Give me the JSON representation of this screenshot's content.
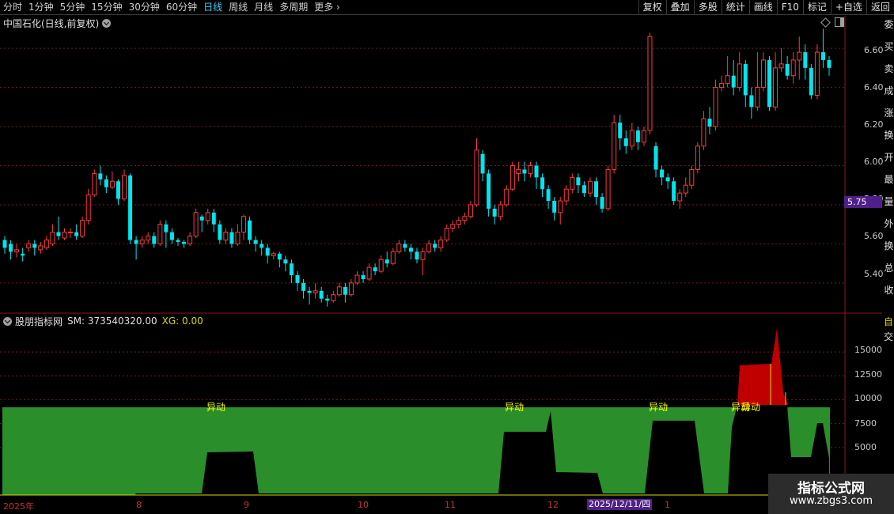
{
  "toolbar": {
    "periods": [
      "分时",
      "1分钟",
      "5分钟",
      "15分钟",
      "30分钟",
      "60分钟",
      "日线",
      "周线",
      "月线",
      "多周期",
      "更多"
    ],
    "active_period": "日线",
    "actions": [
      "复权",
      "叠加",
      "多股",
      "统计",
      "画线",
      "F10",
      "标记",
      "+自选",
      "返回"
    ]
  },
  "stock_title": "中国石化(日线,前复权)",
  "price_axis": [
    "6.60",
    "6.40",
    "6.20",
    "6.00",
    "5.80",
    "5.60",
    "5.40"
  ],
  "current_price_tag": "5.75",
  "right_strip_chars": [
    "委",
    "买",
    "卖",
    "成",
    "涨",
    "换",
    "开",
    "最",
    "量",
    "外",
    "换",
    "总",
    "收"
  ],
  "indicator": {
    "name": "股朋指标网",
    "sm_text": "SM: 373540320.00",
    "xg_text": "XG: 0.00",
    "axis": [
      "15000",
      "12500",
      "10000",
      "7500",
      "5000"
    ],
    "axis_top_char": "自",
    "axis_top_char2": "交",
    "yidong_labels": [
      "异动",
      "异动",
      "异动",
      "异动",
      "异动"
    ]
  },
  "date_axis": {
    "labels": [
      "2025年",
      "8",
      "9",
      "10",
      "11",
      "12",
      "1"
    ],
    "highlight": "2025/12/11/四"
  },
  "watermark": {
    "title": "指标公式网",
    "url": "www.zbgs3.com"
  },
  "colors": {
    "up": "#ff3b3b",
    "down": "#00e5ee",
    "green_fill": "#2a8f2a",
    "red_fill": "#c00000",
    "grid": "#7a1a1a",
    "highlight": "#50208a"
  },
  "chart_data": {
    "type": "candlestick",
    "ylim": [
      5.25,
      6.75
    ],
    "candles": [
      [
        5.62,
        5.58,
        5.55,
        5.64
      ],
      [
        5.6,
        5.56,
        5.52,
        5.62
      ],
      [
        5.56,
        5.57,
        5.53,
        5.6
      ],
      [
        5.55,
        5.54,
        5.51,
        5.58
      ],
      [
        5.58,
        5.6,
        5.56,
        5.62
      ],
      [
        5.6,
        5.58,
        5.54,
        5.62
      ],
      [
        5.57,
        5.59,
        5.55,
        5.61
      ],
      [
        5.58,
        5.62,
        5.57,
        5.64
      ],
      [
        5.6,
        5.66,
        5.59,
        5.7
      ],
      [
        5.66,
        5.64,
        5.62,
        5.74
      ],
      [
        5.63,
        5.66,
        5.62,
        5.68
      ],
      [
        5.66,
        5.66,
        5.63,
        5.68
      ],
      [
        5.66,
        5.64,
        5.62,
        5.7
      ],
      [
        5.64,
        5.72,
        5.63,
        5.74
      ],
      [
        5.72,
        5.85,
        5.7,
        5.88
      ],
      [
        5.85,
        5.96,
        5.84,
        5.98
      ],
      [
        5.96,
        5.93,
        5.9,
        6.0
      ],
      [
        5.93,
        5.89,
        5.86,
        5.95
      ],
      [
        5.89,
        5.92,
        5.88,
        5.97
      ],
      [
        5.92,
        5.83,
        5.8,
        5.93
      ],
      [
        5.83,
        5.95,
        5.82,
        5.98
      ],
      [
        5.95,
        5.62,
        5.6,
        5.96
      ],
      [
        5.62,
        5.6,
        5.52,
        5.64
      ],
      [
        5.6,
        5.62,
        5.58,
        5.64
      ],
      [
        5.62,
        5.64,
        5.6,
        5.66
      ],
      [
        5.64,
        5.6,
        5.58,
        5.66
      ],
      [
        5.6,
        5.7,
        5.59,
        5.72
      ],
      [
        5.7,
        5.66,
        5.58,
        5.72
      ],
      [
        5.66,
        5.62,
        5.6,
        5.68
      ],
      [
        5.62,
        5.61,
        5.59,
        5.63
      ],
      [
        5.61,
        5.6,
        5.58,
        5.62
      ],
      [
        5.6,
        5.64,
        5.59,
        5.66
      ],
      [
        5.64,
        5.76,
        5.63,
        5.78
      ],
      [
        5.74,
        5.72,
        5.66,
        5.75
      ],
      [
        5.72,
        5.76,
        5.7,
        5.78
      ],
      [
        5.76,
        5.7,
        5.66,
        5.78
      ],
      [
        5.7,
        5.62,
        5.6,
        5.72
      ],
      [
        5.62,
        5.66,
        5.6,
        5.68
      ],
      [
        5.66,
        5.6,
        5.58,
        5.68
      ],
      [
        5.6,
        5.66,
        5.59,
        5.7
      ],
      [
        5.66,
        5.74,
        5.62,
        5.75
      ],
      [
        5.72,
        5.62,
        5.6,
        5.74
      ],
      [
        5.62,
        5.6,
        5.56,
        5.64
      ],
      [
        5.6,
        5.58,
        5.54,
        5.62
      ],
      [
        5.58,
        5.54,
        5.5,
        5.6
      ],
      [
        5.54,
        5.55,
        5.52,
        5.56
      ],
      [
        5.55,
        5.52,
        5.48,
        5.56
      ],
      [
        5.52,
        5.5,
        5.46,
        5.54
      ],
      [
        5.5,
        5.44,
        5.4,
        5.52
      ],
      [
        5.44,
        5.4,
        5.36,
        5.46
      ],
      [
        5.4,
        5.36,
        5.32,
        5.42
      ],
      [
        5.36,
        5.35,
        5.29,
        5.38
      ],
      [
        5.35,
        5.36,
        5.32,
        5.4
      ],
      [
        5.36,
        5.32,
        5.3,
        5.38
      ],
      [
        5.32,
        5.31,
        5.28,
        5.34
      ],
      [
        5.31,
        5.34,
        5.3,
        5.36
      ],
      [
        5.34,
        5.38,
        5.33,
        5.4
      ],
      [
        5.38,
        5.34,
        5.3,
        5.4
      ],
      [
        5.34,
        5.4,
        5.33,
        5.42
      ],
      [
        5.4,
        5.44,
        5.39,
        5.46
      ],
      [
        5.44,
        5.42,
        5.4,
        5.46
      ],
      [
        5.42,
        5.48,
        5.41,
        5.5
      ],
      [
        5.48,
        5.46,
        5.44,
        5.5
      ],
      [
        5.46,
        5.52,
        5.45,
        5.54
      ],
      [
        5.52,
        5.5,
        5.48,
        5.56
      ],
      [
        5.5,
        5.56,
        5.49,
        5.58
      ],
      [
        5.56,
        5.6,
        5.55,
        5.62
      ],
      [
        5.6,
        5.58,
        5.56,
        5.62
      ],
      [
        5.58,
        5.56,
        5.52,
        5.6
      ],
      [
        5.56,
        5.52,
        5.5,
        5.58
      ],
      [
        5.52,
        5.56,
        5.44,
        5.58
      ],
      [
        5.56,
        5.6,
        5.55,
        5.62
      ],
      [
        5.6,
        5.58,
        5.56,
        5.62
      ],
      [
        5.58,
        5.62,
        5.56,
        5.64
      ],
      [
        5.62,
        5.68,
        5.61,
        5.7
      ],
      [
        5.68,
        5.7,
        5.66,
        5.72
      ],
      [
        5.7,
        5.72,
        5.68,
        5.74
      ],
      [
        5.72,
        5.74,
        5.7,
        5.76
      ],
      [
        5.74,
        5.8,
        5.73,
        5.82
      ],
      [
        5.8,
        6.08,
        5.79,
        6.14
      ],
      [
        6.06,
        5.96,
        5.92,
        6.08
      ],
      [
        5.96,
        5.78,
        5.74,
        5.98
      ],
      [
        5.78,
        5.74,
        5.7,
        5.8
      ],
      [
        5.74,
        5.8,
        5.72,
        5.82
      ],
      [
        5.8,
        5.88,
        5.79,
        5.9
      ],
      [
        5.88,
        6.0,
        5.87,
        6.02
      ],
      [
        5.96,
        5.98,
        5.92,
        6.02
      ],
      [
        5.98,
        5.96,
        5.92,
        6.02
      ],
      [
        5.96,
        6.0,
        5.94,
        6.02
      ],
      [
        6.0,
        5.94,
        5.88,
        6.02
      ],
      [
        5.94,
        5.88,
        5.84,
        5.96
      ],
      [
        5.88,
        5.82,
        5.78,
        5.9
      ],
      [
        5.82,
        5.76,
        5.72,
        5.84
      ],
      [
        5.76,
        5.82,
        5.7,
        5.84
      ],
      [
        5.82,
        5.88,
        5.8,
        5.9
      ],
      [
        5.88,
        5.94,
        5.86,
        5.96
      ],
      [
        5.94,
        5.9,
        5.86,
        5.96
      ],
      [
        5.9,
        5.86,
        5.84,
        5.92
      ],
      [
        5.86,
        5.92,
        5.84,
        5.94
      ],
      [
        5.92,
        5.84,
        5.8,
        5.94
      ],
      [
        5.84,
        5.78,
        5.76,
        5.86
      ],
      [
        5.78,
        5.98,
        5.77,
        6.0
      ],
      [
        5.98,
        6.22,
        5.96,
        6.26
      ],
      [
        6.22,
        6.14,
        6.08,
        6.26
      ],
      [
        6.14,
        6.1,
        6.06,
        6.18
      ],
      [
        6.1,
        6.18,
        6.08,
        6.22
      ],
      [
        6.18,
        6.12,
        6.08,
        6.2
      ],
      [
        6.12,
        6.18,
        6.1,
        6.2
      ],
      [
        6.18,
        6.66,
        6.16,
        6.68
      ],
      [
        6.1,
        5.98,
        5.94,
        6.12
      ],
      [
        5.98,
        5.94,
        5.9,
        6.0
      ],
      [
        5.94,
        5.92,
        5.88,
        5.96
      ],
      [
        5.92,
        5.82,
        5.8,
        5.94
      ],
      [
        5.82,
        5.86,
        5.78,
        5.88
      ],
      [
        5.86,
        5.9,
        5.84,
        5.94
      ],
      [
        5.9,
        5.98,
        5.88,
        6.0
      ],
      [
        5.98,
        6.1,
        5.96,
        6.12
      ],
      [
        6.1,
        6.24,
        6.08,
        6.28
      ],
      [
        6.24,
        6.2,
        6.16,
        6.3
      ],
      [
        6.2,
        6.4,
        6.18,
        6.44
      ],
      [
        6.4,
        6.42,
        6.38,
        6.46
      ],
      [
        6.42,
        6.46,
        6.4,
        6.56
      ],
      [
        6.46,
        6.4,
        6.36,
        6.54
      ],
      [
        6.4,
        6.52,
        6.38,
        6.58
      ],
      [
        6.52,
        6.36,
        6.3,
        6.54
      ],
      [
        6.36,
        6.3,
        6.24,
        6.4
      ],
      [
        6.3,
        6.4,
        6.28,
        6.58
      ],
      [
        6.4,
        6.54,
        6.38,
        6.58
      ],
      [
        6.54,
        6.3,
        6.28,
        6.56
      ],
      [
        6.3,
        6.5,
        6.28,
        6.58
      ],
      [
        6.5,
        6.52,
        6.48,
        6.6
      ],
      [
        6.52,
        6.46,
        6.44,
        6.56
      ],
      [
        6.46,
        6.54,
        6.42,
        6.58
      ],
      [
        6.54,
        6.58,
        6.44,
        6.66
      ],
      [
        6.58,
        6.5,
        6.44,
        6.62
      ],
      [
        6.5,
        6.36,
        6.34,
        6.52
      ],
      [
        6.36,
        6.58,
        6.34,
        6.62
      ],
      [
        6.58,
        6.54,
        6.5,
        6.7
      ],
      [
        6.54,
        6.5,
        6.46,
        6.56
      ]
    ],
    "indicator_green_band": 9200,
    "indicator_axis_range": [
      0,
      17500
    ]
  }
}
